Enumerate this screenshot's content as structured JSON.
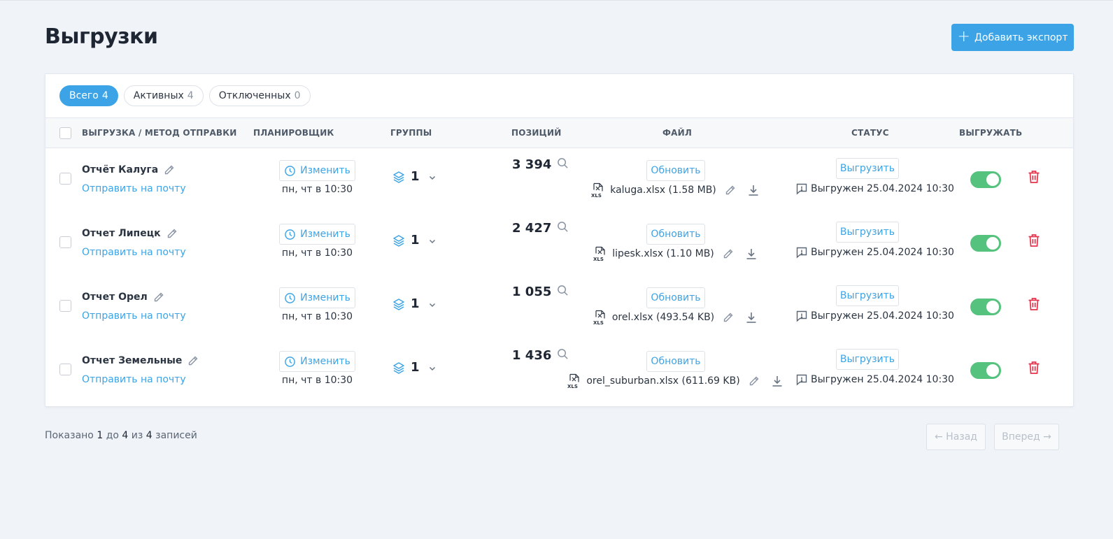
{
  "page": {
    "title": "Выгрузки",
    "add_button": "Добавить экспорт"
  },
  "filters": [
    {
      "label": "Всего",
      "count": "4"
    },
    {
      "label": "Активных",
      "count": "4"
    },
    {
      "label": "Отключенных",
      "count": "0"
    }
  ],
  "table": {
    "headers": {
      "name": "ВЫГРУЗКА / МЕТОД ОТПРАВКИ",
      "scheduler": "ПЛАНИРОВЩИК",
      "groups": "ГРУППЫ",
      "positions": "ПОЗИЦИЙ",
      "file": "ФАЙЛ",
      "status": "СТАТУС",
      "export": "ВЫГРУЖАТЬ"
    },
    "rows": [
      {
        "name": "Отчёт Калуга",
        "method": "Отправить на почту",
        "sched_button": "Изменить",
        "schedule": "пн, чт в 10:30",
        "groups": "1",
        "positions": "3 394",
        "update_button": "Обновить",
        "file": "kaluga.xlsx (1.58 MB)",
        "export_button": "Выгрузить",
        "status": "Выгружен 25.04.2024 10:30"
      },
      {
        "name": "Отчет Липецк",
        "method": "Отправить на почту",
        "sched_button": "Изменить",
        "schedule": "пн, чт в 10:30",
        "groups": "1",
        "positions": "2 427",
        "update_button": "Обновить",
        "file": "lipesk.xlsx (1.10 MB)",
        "export_button": "Выгрузить",
        "status": "Выгружен 25.04.2024 10:30"
      },
      {
        "name": "Отчет Орел",
        "method": "Отправить на почту",
        "sched_button": "Изменить",
        "schedule": "пн, чт в 10:30",
        "groups": "1",
        "positions": "1 055",
        "update_button": "Обновить",
        "file": "orel.xlsx (493.54 KB)",
        "export_button": "Выгрузить",
        "status": "Выгружен 25.04.2024 10:30"
      },
      {
        "name": "Отчет Земельные",
        "method": "Отправить на почту",
        "sched_button": "Изменить",
        "schedule": "пн, чт в 10:30",
        "groups": "1",
        "positions": "1 436",
        "update_button": "Обновить",
        "file": "orel_suburban.xlsx (611.69 KB)",
        "export_button": "Выгрузить",
        "status": "Выгружен 25.04.2024 10:30"
      }
    ]
  },
  "footer": {
    "shown": "Показано",
    "from": "1",
    "to_word": "до",
    "to": "4",
    "of_word": "из",
    "total": "4",
    "records": "записей",
    "prev": "← Назад",
    "next": "Вперед →"
  },
  "colors": {
    "accent": "#3ca4e6",
    "toggle_on": "#55c27d",
    "danger": "#e5334b"
  }
}
